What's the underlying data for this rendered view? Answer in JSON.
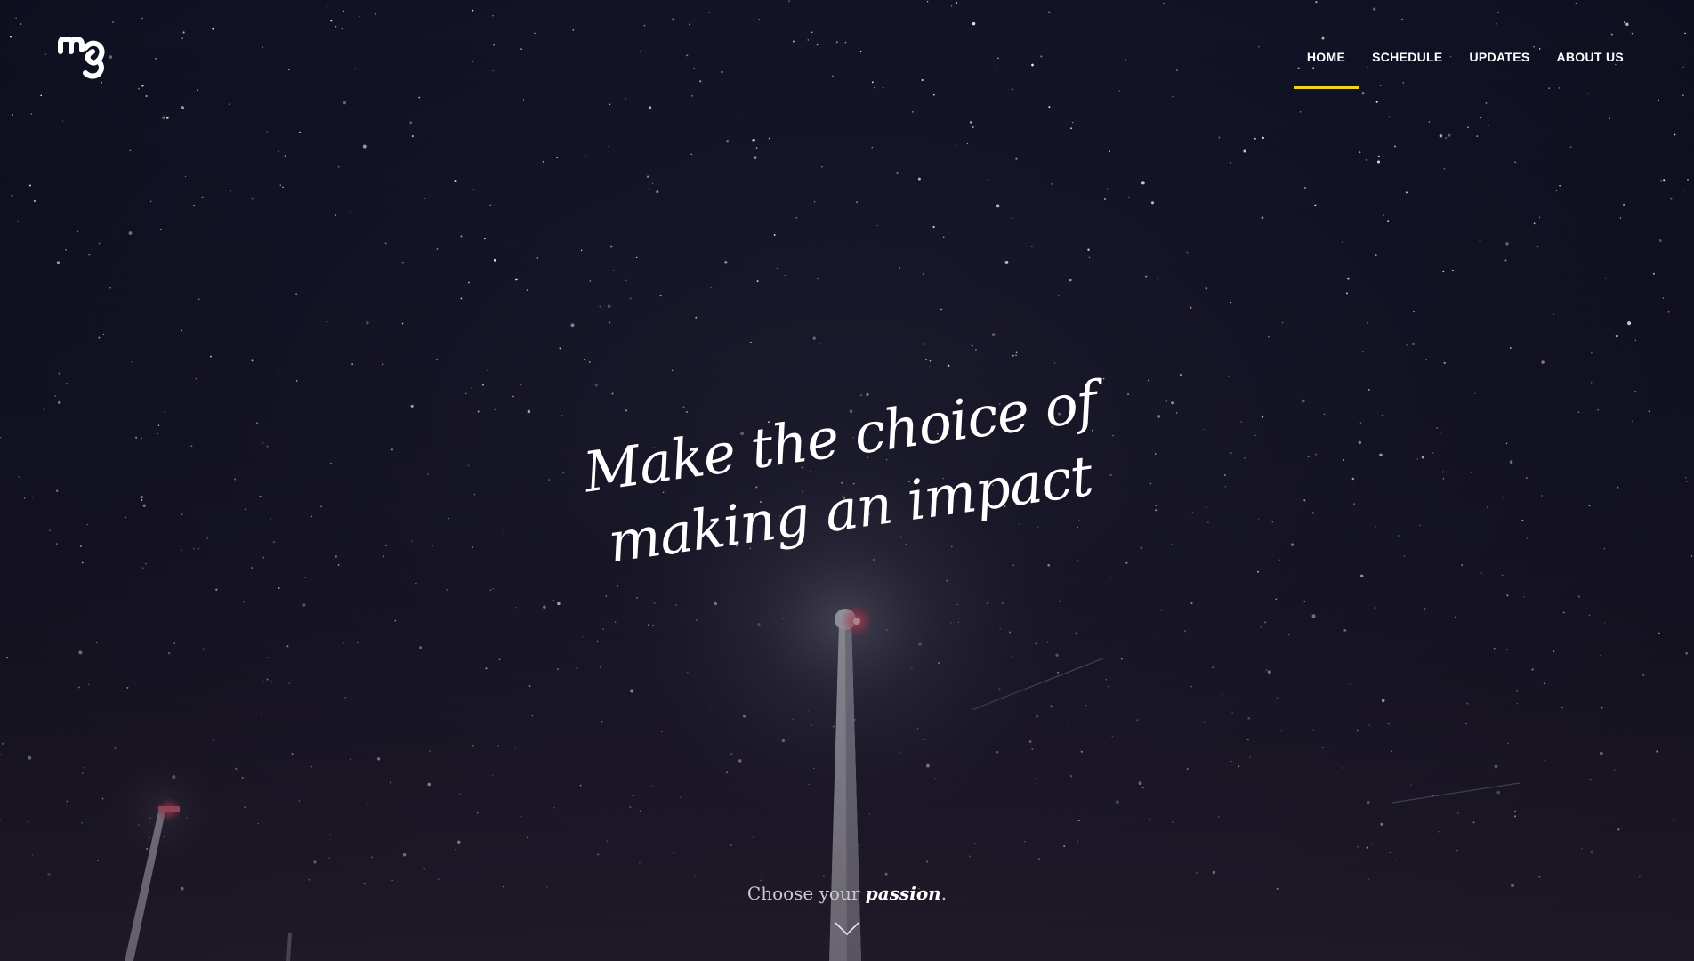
{
  "brand": {
    "logo_icon": "mg-logo-icon"
  },
  "nav": {
    "items": [
      {
        "label": "HOME",
        "active": true
      },
      {
        "label": "SCHEDULE",
        "active": false
      },
      {
        "label": "UPDATES",
        "active": false
      },
      {
        "label": "ABOUT US",
        "active": false
      }
    ],
    "active_color": "#f0d61a"
  },
  "hero": {
    "headline": "Make the choice of making an impact",
    "tagline_prefix": "Choose your",
    "tagline_emphasis": "passion",
    "tagline_suffix": ".",
    "scroll_icon": "chevron-down-icon"
  }
}
